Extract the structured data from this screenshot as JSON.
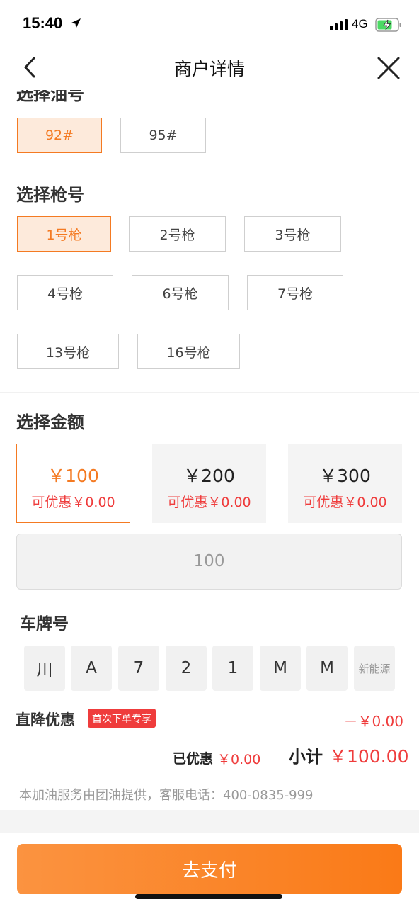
{
  "status_bar": {
    "time": "15:40",
    "network": "4G"
  },
  "nav": {
    "title": "商户详情"
  },
  "oil": {
    "title": "选择油号",
    "options": [
      "92#",
      "95#"
    ],
    "selected": "92#"
  },
  "gun": {
    "title": "选择枪号",
    "options": [
      "1号枪",
      "2号枪",
      "3号枪",
      "4号枪",
      "6号枪",
      "7号枪",
      "13号枪",
      "16号枪"
    ],
    "selected": "1号枪"
  },
  "amount": {
    "title": "选择金额",
    "cards": [
      {
        "value": "￥100",
        "discount": "可优惠￥0.00"
      },
      {
        "value": "￥200",
        "discount": "可优惠￥0.00"
      },
      {
        "value": "￥300",
        "discount": "可优惠￥0.00"
      }
    ],
    "selected_index": 0,
    "input_value": "100"
  },
  "plate": {
    "title": "车牌号",
    "chars": [
      "川",
      "A",
      "7",
      "2",
      "1",
      "M",
      "M"
    ],
    "new_energy": "新能源"
  },
  "discount": {
    "label": "直降优惠",
    "badge": "首次下单专享",
    "amount": "－￥0.00"
  },
  "summary": {
    "saved_label": "已优惠",
    "saved_value": "￥0.00",
    "subtotal_label": "小计",
    "subtotal_value": "￥100.00"
  },
  "footer_note": "本加油服务由团油提供，客服电话：400-0835-999",
  "pay_button": "去支付",
  "colors": {
    "accent": "#f47a22",
    "price_red": "#ef3c3c",
    "selected_bg": "#fdeadb"
  }
}
